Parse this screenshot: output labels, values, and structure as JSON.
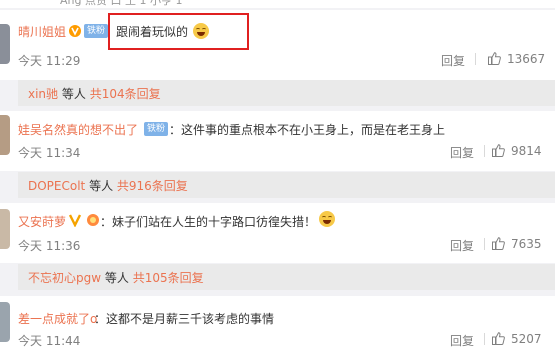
{
  "top_partial_text": "Ang 点赞 口 土 1 小亨 1",
  "comments": [
    {
      "user": "晴川姐姐",
      "badge": "铁粉",
      "text": "跟闹着玩似的",
      "time": "今天 11:29",
      "reply_label": "回复",
      "likes": "13667",
      "sub_reply": {
        "user": "xin驰",
        "middle": " 等人 ",
        "link": "共104条回复"
      }
    },
    {
      "user": "娃吴名然真的想不出了",
      "badge": "铁粉",
      "text": "：这件事的重点根本不在小王身上，而是在老王身上",
      "time": "今天 11:34",
      "reply_label": "回复",
      "likes": "9814",
      "sub_reply": {
        "user": "DOPEColt",
        "middle": " 等人 ",
        "link": "共916条回复"
      }
    },
    {
      "user": "又安莳萝",
      "badge": "",
      "text": "：妹子们站在人生的十字路口彷徨失措！",
      "time": "今天 11:36",
      "reply_label": "回复",
      "likes": "7635",
      "sub_reply": {
        "user": "不忘初心pgw",
        "middle": " 等人 ",
        "link": "共105条回复"
      }
    },
    {
      "user": "差一点成就了o",
      "badge": "",
      "text": "：这都不是月薪三千该考虑的事情",
      "time": "今天 11:44",
      "reply_label": "回复",
      "likes": "5207",
      "sub_reply": null
    }
  ],
  "colors": {
    "username": "#eb7350",
    "highlight_box": "#e02020",
    "badge": "#7fb2e8"
  },
  "icons": [
    "thumbs-up-icon",
    "vip-v-icon",
    "laughing-emoji-icon",
    "fan-badge-icon"
  ]
}
